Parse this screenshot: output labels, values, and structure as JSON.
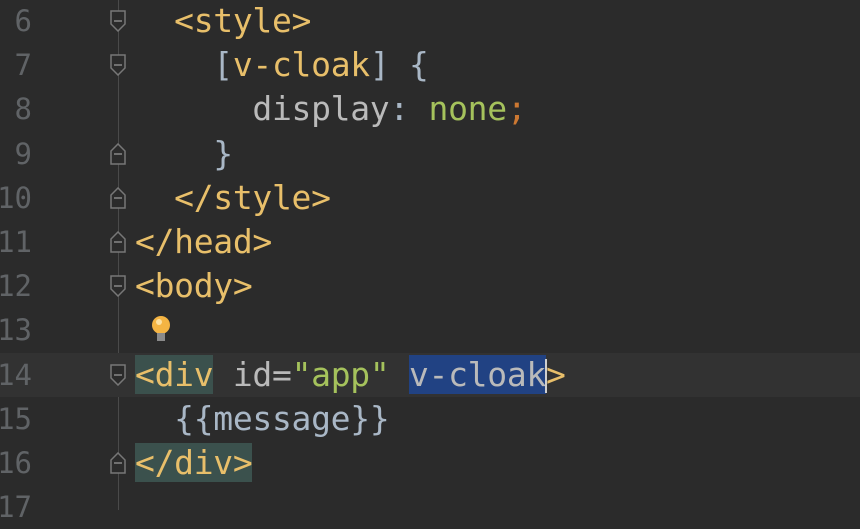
{
  "editor": {
    "current_line": 14,
    "lines": [
      {
        "number": "6",
        "indent": "  ",
        "fold": "start",
        "tokens": [
          {
            "t": "t-tag",
            "text": "<style>"
          }
        ]
      },
      {
        "number": "7",
        "indent": "    ",
        "fold": "start",
        "tokens": [
          {
            "t": "t-punct",
            "text": "["
          },
          {
            "t": "t-sel",
            "text": "v-cloak"
          },
          {
            "t": "t-punct",
            "text": "] {"
          }
        ]
      },
      {
        "number": "8",
        "indent": "      ",
        "fold": "",
        "tokens": [
          {
            "t": "t-prop",
            "text": "display"
          },
          {
            "t": "t-punct",
            "text": ": "
          },
          {
            "t": "t-val",
            "text": "none"
          },
          {
            "t": "t-semi",
            "text": ";"
          }
        ]
      },
      {
        "number": "9",
        "indent": "    ",
        "fold": "end",
        "tokens": [
          {
            "t": "t-punct",
            "text": "}"
          }
        ]
      },
      {
        "number": "10",
        "indent": "  ",
        "fold": "end",
        "tokens": [
          {
            "t": "t-tag",
            "text": "</style>"
          }
        ]
      },
      {
        "number": "11",
        "indent": "",
        "fold": "end",
        "tokens": [
          {
            "t": "t-tag",
            "text": "</head>"
          }
        ]
      },
      {
        "number": "12",
        "indent": "",
        "fold": "start",
        "tokens": [
          {
            "t": "t-tag",
            "text": "<body>"
          }
        ]
      },
      {
        "number": "13",
        "indent": "",
        "fold": "",
        "bulb": true,
        "tokens": []
      },
      {
        "number": "14",
        "indent": "",
        "fold": "start",
        "tokens": [
          {
            "t": "t-tag hl-tag",
            "text": "<div"
          },
          {
            "t": "t-attr",
            "text": " id="
          },
          {
            "t": "t-str",
            "text": "\"app\""
          },
          {
            "t": "t-attr",
            "text": " "
          },
          {
            "t": "t-attr sel",
            "text": "v-cloak",
            "caret": true
          },
          {
            "t": "t-tag",
            "text": ">"
          }
        ]
      },
      {
        "number": "15",
        "indent": "  ",
        "fold": "",
        "tokens": [
          {
            "t": "t-punct",
            "text": "{{message}}"
          }
        ]
      },
      {
        "number": "16",
        "indent": "",
        "fold": "end",
        "tokens": [
          {
            "t": "t-tag hl-tag",
            "text": "</div>"
          }
        ]
      },
      {
        "number": "17",
        "indent": "",
        "fold": "",
        "tokens": []
      }
    ]
  },
  "colors": {
    "background": "#2b2b2b",
    "tag": "#e8bf6a",
    "string": "#a5c25c",
    "selection": "#214283",
    "tag_highlight": "#3b514d"
  }
}
